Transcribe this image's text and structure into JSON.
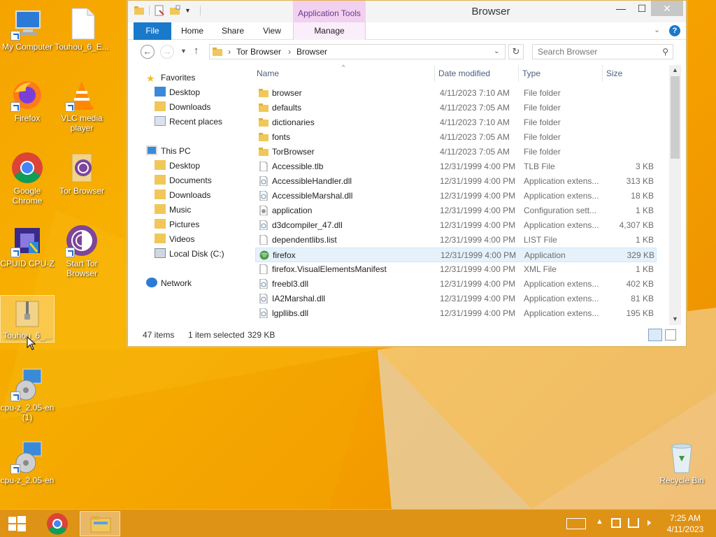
{
  "desktop": {
    "icons": [
      {
        "label": "My Computer",
        "name": "my-computer"
      },
      {
        "label": "Touhou_6_E...",
        "name": "touhou-file"
      },
      {
        "label": "Firefox",
        "name": "firefox"
      },
      {
        "label": "VLC media player",
        "name": "vlc"
      },
      {
        "label": "Google Chrome",
        "name": "chrome"
      },
      {
        "label": "Tor Browser",
        "name": "tor-browser"
      },
      {
        "label": "CPUID CPU-Z",
        "name": "cpuz"
      },
      {
        "label": "Start Tor Browser",
        "name": "start-tor"
      },
      {
        "label": "Touhou_6_...",
        "name": "touhou-zip"
      },
      {
        "label": "cpu-z_2.05-en (1)",
        "name": "cpuz-installer-1"
      },
      {
        "label": "cpu-z_2.05-en",
        "name": "cpuz-installer"
      },
      {
        "label": "Recycle Bin",
        "name": "recycle-bin"
      }
    ]
  },
  "window": {
    "title": "Browser",
    "context_tab": "Application Tools",
    "ribbon_tabs": [
      "File",
      "Home",
      "Share",
      "View",
      "Manage"
    ],
    "controls": {
      "min": "—",
      "max": "☐",
      "close": "✕"
    },
    "address": {
      "crumbs": [
        "Tor Browser",
        "Browser"
      ]
    },
    "search_placeholder": "Search Browser",
    "nav_pane": {
      "favorites": "Favorites",
      "favorite_items": [
        "Desktop",
        "Downloads",
        "Recent places"
      ],
      "this_pc": "This PC",
      "pc_items": [
        "Desktop",
        "Documents",
        "Downloads",
        "Music",
        "Pictures",
        "Videos",
        "Local Disk (C:)"
      ],
      "network": "Network"
    },
    "columns": {
      "name": "Name",
      "date": "Date modified",
      "type": "Type",
      "size": "Size"
    },
    "files": [
      {
        "name": "browser",
        "date": "4/11/2023 7:10 AM",
        "type": "File folder",
        "size": "",
        "icon": "folder"
      },
      {
        "name": "defaults",
        "date": "4/11/2023 7:05 AM",
        "type": "File folder",
        "size": "",
        "icon": "folder"
      },
      {
        "name": "dictionaries",
        "date": "4/11/2023 7:10 AM",
        "type": "File folder",
        "size": "",
        "icon": "folder"
      },
      {
        "name": "fonts",
        "date": "4/11/2023 7:05 AM",
        "type": "File folder",
        "size": "",
        "icon": "folder"
      },
      {
        "name": "TorBrowser",
        "date": "4/11/2023 7:05 AM",
        "type": "File folder",
        "size": "",
        "icon": "folder"
      },
      {
        "name": "Accessible.tlb",
        "date": "12/31/1999 4:00 PM",
        "type": "TLB File",
        "size": "3 KB",
        "icon": "file"
      },
      {
        "name": "AccessibleHandler.dll",
        "date": "12/31/1999 4:00 PM",
        "type": "Application extens...",
        "size": "313 KB",
        "icon": "dll"
      },
      {
        "name": "AccessibleMarshal.dll",
        "date": "12/31/1999 4:00 PM",
        "type": "Application extens...",
        "size": "18 KB",
        "icon": "dll"
      },
      {
        "name": "application",
        "date": "12/31/1999 4:00 PM",
        "type": "Configuration sett...",
        "size": "1 KB",
        "icon": "config"
      },
      {
        "name": "d3dcompiler_47.dll",
        "date": "12/31/1999 4:00 PM",
        "type": "Application extens...",
        "size": "4,307 KB",
        "icon": "dll"
      },
      {
        "name": "dependentlibs.list",
        "date": "12/31/1999 4:00 PM",
        "type": "LIST File",
        "size": "1 KB",
        "icon": "file"
      },
      {
        "name": "firefox",
        "date": "12/31/1999 4:00 PM",
        "type": "Application",
        "size": "329 KB",
        "icon": "globe",
        "selected": true
      },
      {
        "name": "firefox.VisualElementsManifest",
        "date": "12/31/1999 4:00 PM",
        "type": "XML File",
        "size": "1 KB",
        "icon": "file"
      },
      {
        "name": "freebl3.dll",
        "date": "12/31/1999 4:00 PM",
        "type": "Application extens...",
        "size": "402 KB",
        "icon": "dll"
      },
      {
        "name": "IA2Marshal.dll",
        "date": "12/31/1999 4:00 PM",
        "type": "Application extens...",
        "size": "81 KB",
        "icon": "dll"
      },
      {
        "name": "lgpllibs.dll",
        "date": "12/31/1999 4:00 PM",
        "type": "Application extens...",
        "size": "195 KB",
        "icon": "dll"
      }
    ],
    "status": {
      "count": "47 items",
      "selection": "1 item selected",
      "size": "329 KB"
    }
  },
  "taskbar": {
    "clock_time": "7:25 AM",
    "clock_date": "4/11/2023"
  }
}
